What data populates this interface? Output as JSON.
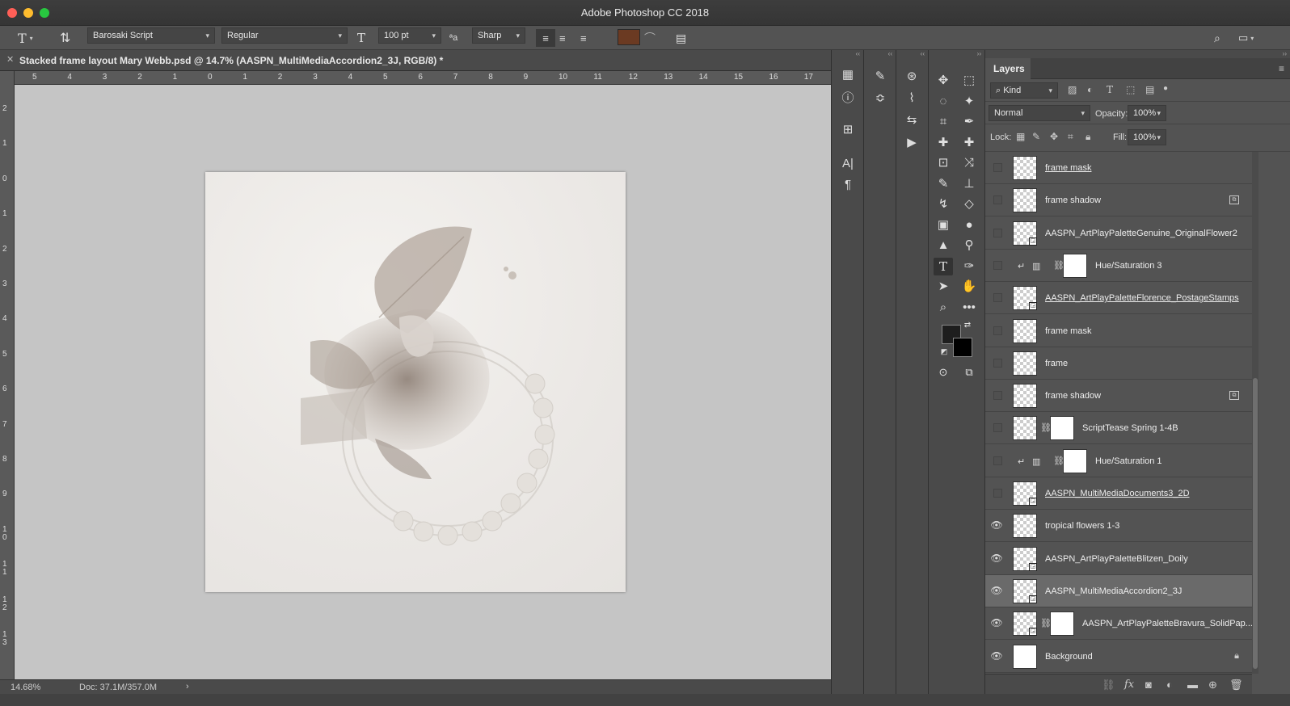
{
  "window": {
    "title": "Adobe Photoshop CC 2018"
  },
  "options_bar": {
    "font_family": "Barosaki Script",
    "font_style": "Regular",
    "font_size": "100 pt",
    "antialias": "Sharp",
    "text_color": "#6b3a22"
  },
  "document": {
    "tab_title": "Stacked frame layout Mary Webb.psd @ 14.7% (AASPN_MultiMediaAccordion2_3J, RGB/8) *",
    "close_glyph": "✕"
  },
  "ruler_h": [
    "5",
    "4",
    "3",
    "2",
    "1",
    "0",
    "1",
    "2",
    "3",
    "4",
    "5",
    "6",
    "7",
    "8",
    "9",
    "10",
    "11",
    "12",
    "13",
    "14",
    "15",
    "16",
    "17"
  ],
  "ruler_v": [
    "2",
    "1",
    "0",
    "1",
    "2",
    "3",
    "4",
    "5",
    "6",
    "7",
    "8",
    "9",
    "1 0",
    "1 1",
    "1 2",
    "1 3"
  ],
  "status": {
    "zoom": "14.68%",
    "doc_size": "Doc: 37.1M/357.0M",
    "arrow": "›"
  },
  "layers_panel": {
    "tab": "Layers",
    "filter_kind": "Kind",
    "blend_mode": "Normal",
    "opacity_label": "Opacity:",
    "opacity_value": "100%",
    "lock_label": "Lock:",
    "fill_label": "Fill:",
    "fill_value": "100%",
    "layers": [
      {
        "name": "frame mask",
        "visible": false,
        "underline": true,
        "type": "pixel"
      },
      {
        "name": "frame shadow",
        "visible": false,
        "underline": false,
        "type": "pixel",
        "fx": true
      },
      {
        "name": "AASPN_ArtPlayPaletteGenuine_OriginalFlower2",
        "visible": false,
        "underline": false,
        "type": "smart"
      },
      {
        "name": "Hue/Saturation 3",
        "visible": false,
        "underline": false,
        "type": "adjustment"
      },
      {
        "name": "AASPN_ArtPlayPaletteFlorence_PostageStamps",
        "visible": false,
        "underline": true,
        "type": "smart"
      },
      {
        "name": "frame mask",
        "visible": false,
        "underline": false,
        "type": "pixel"
      },
      {
        "name": "frame",
        "visible": false,
        "underline": false,
        "type": "pixel"
      },
      {
        "name": "frame shadow",
        "visible": false,
        "underline": false,
        "type": "pixel",
        "fx": true
      },
      {
        "name": "ScriptTease Spring 1-4B",
        "visible": false,
        "underline": false,
        "type": "masked"
      },
      {
        "name": "Hue/Saturation 1",
        "visible": false,
        "underline": false,
        "type": "adjustment"
      },
      {
        "name": "AASPN_MultiMediaDocuments3_2D",
        "visible": false,
        "underline": true,
        "type": "smart"
      },
      {
        "name": "tropical flowers 1-3",
        "visible": true,
        "underline": false,
        "type": "pixel"
      },
      {
        "name": "AASPN_ArtPlayPaletteBlitzen_Doily",
        "visible": true,
        "underline": false,
        "type": "smart"
      },
      {
        "name": "AASPN_MultiMediaAccordion2_3J",
        "visible": true,
        "underline": false,
        "type": "smart",
        "selected": true
      },
      {
        "name": "AASPN_ArtPlayPaletteBravura_SolidPap...",
        "visible": true,
        "underline": false,
        "type": "smart-masked"
      },
      {
        "name": "Background",
        "visible": true,
        "underline": false,
        "type": "background",
        "locked": true
      }
    ]
  }
}
